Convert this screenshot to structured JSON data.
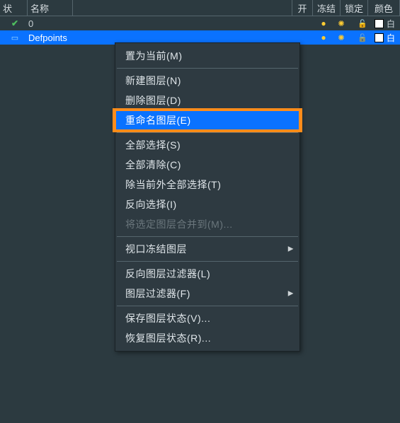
{
  "header": {
    "status": "状",
    "name": "名称",
    "open": "开",
    "freeze": "冻结",
    "lock": "锁定",
    "color": "颜色"
  },
  "layers": [
    {
      "status_icon": "check",
      "name": "0",
      "open_icon": "bulb-on",
      "freeze_icon": "sun",
      "lock_icon": "lock",
      "color_label": "白",
      "selected": false
    },
    {
      "status_icon": "cloud",
      "name": "Defpoints",
      "open_icon": "bulb-on",
      "freeze_icon": "sun",
      "lock_icon": "lock dim",
      "color_label": "白",
      "selected": true
    }
  ],
  "menu": {
    "set_current": "置为当前(M)",
    "new_layer": "新建图层(N)",
    "delete_layer": "删除图层(D)",
    "rename_layer": "重命名图层(E)",
    "select_all": "全部选择(S)",
    "clear_all": "全部清除(C)",
    "select_all_but": "除当前外全部选择(T)",
    "invert_select": "反向选择(I)",
    "merge_selected": "将选定图层合并到(M)...",
    "viewport_freeze": "视口冻结图层",
    "invert_filter": "反向图层过滤器(L)",
    "layer_filter": "图层过滤器(F)",
    "save_state": "保存图层状态(V)...",
    "restore_state": "恢复图层状态(R)..."
  }
}
